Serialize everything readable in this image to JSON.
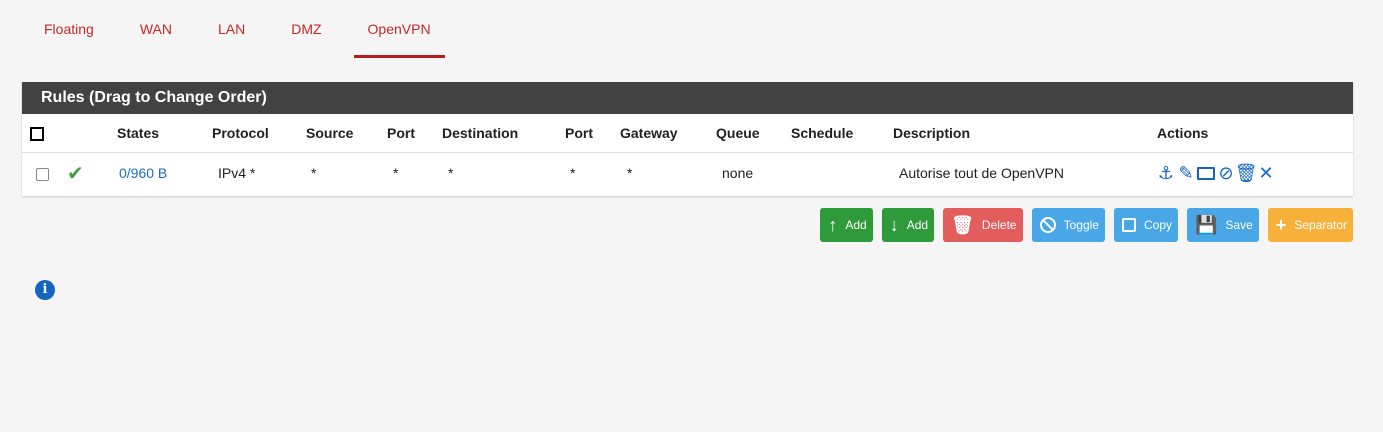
{
  "tabs": [
    "Floating",
    "WAN",
    "LAN",
    "DMZ",
    "OpenVPN"
  ],
  "active_tab": "OpenVPN",
  "panel": {
    "title": "Rules (Drag to Change Order)"
  },
  "table": {
    "headers": [
      "",
      "",
      "States",
      "Protocol",
      "Source",
      "Port",
      "Destination",
      "Port",
      "Gateway",
      "Queue",
      "Schedule",
      "Description",
      "Actions"
    ],
    "rows": [
      {
        "status": "enabled",
        "states": "0/960 B",
        "protocol": "IPv4 *",
        "source": "*",
        "source_port": "*",
        "destination": "*",
        "dest_port": "*",
        "gateway": "*",
        "queue": "none",
        "schedule": "",
        "description": "Autorise tout de OpenVPN"
      }
    ]
  },
  "row_actions": [
    "anchor-icon",
    "pencil-icon",
    "copy-icon",
    "ban-icon",
    "trash-icon",
    "times-icon"
  ],
  "buttons": {
    "add_top": "Add",
    "add_bottom": "Add",
    "delete": "Delete",
    "toggle": "Toggle",
    "copy": "Copy",
    "save": "Save",
    "separator": "Separator"
  },
  "colors": {
    "accent": "#c62828",
    "header_bg": "#424242",
    "green": "#2e9a3a",
    "red": "#e35d5d",
    "blue": "#49a7e8",
    "orange": "#f7b03a",
    "link": "#1e6fb8"
  }
}
